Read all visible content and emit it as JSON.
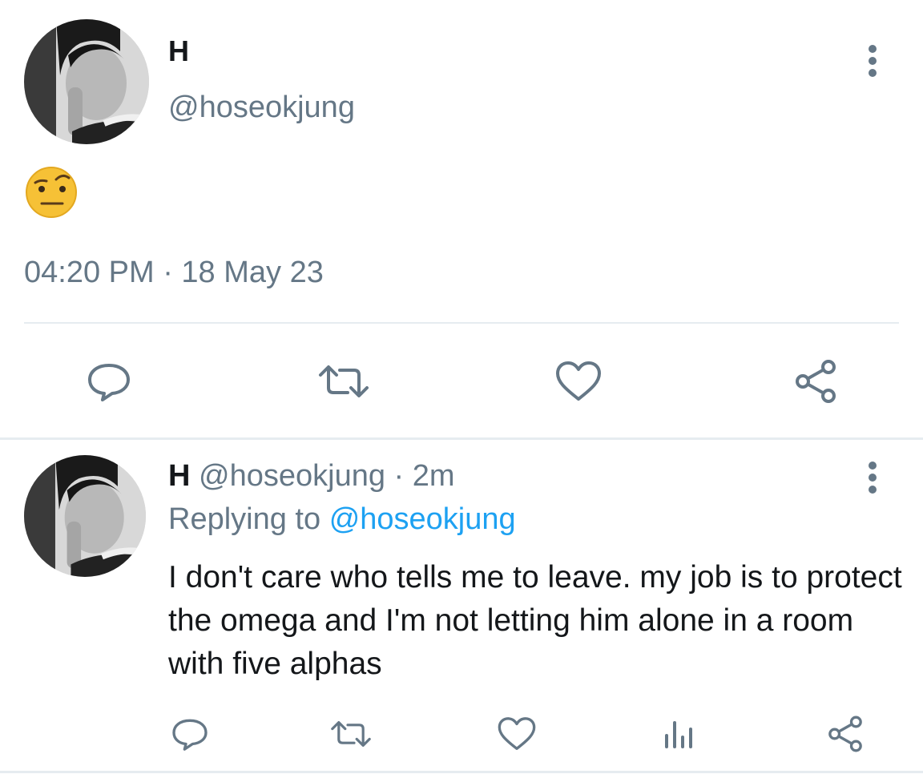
{
  "main_tweet": {
    "display_name": "H",
    "handle": "@hoseokjung",
    "emoji": "🤨",
    "timestamp": "04:20 PM · 18 May 23"
  },
  "reply_tweet": {
    "display_name": "H",
    "handle": "@hoseokjung",
    "separator": "·",
    "time_ago": "2m",
    "replying_prefix": "Replying to",
    "replying_handle": "@hoseokjung",
    "text": "I don't care who tells me to leave. my job is to protect the omega and I'm not letting him alone in a room with five alphas"
  },
  "icons": {
    "reply": "speech-bubble-icon",
    "retweet": "retweet-icon",
    "like": "heart-icon",
    "share": "share-icon",
    "analytics": "bar-chart-icon",
    "more": "vertical-dots-icon"
  },
  "colors": {
    "text": "#14171a",
    "muted": "#657786",
    "link": "#1da1f2",
    "divider": "#e6ecf0"
  }
}
